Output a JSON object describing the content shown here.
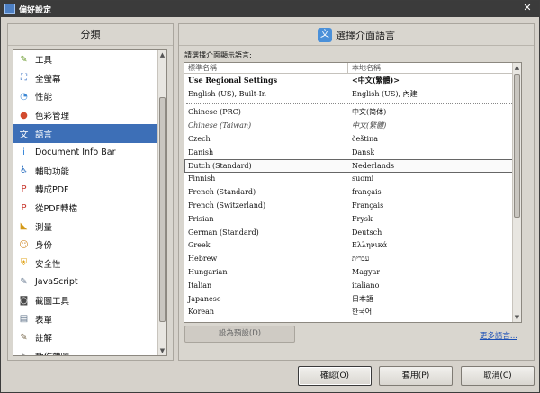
{
  "window": {
    "title": "偏好設定"
  },
  "left": {
    "header": "分類",
    "items": [
      {
        "label": "工具",
        "icon": "tools-icon",
        "color": "#6a9b2e"
      },
      {
        "label": "全螢幕",
        "icon": "fullscreen-icon",
        "color": "#3f76c6"
      },
      {
        "label": "性能",
        "icon": "performance-icon",
        "color": "#3b87d4"
      },
      {
        "label": "色彩管理",
        "icon": "color-management-icon",
        "color": "#d24b2e"
      },
      {
        "label": "語言",
        "icon": "language-icon",
        "color": "#4a90d9"
      },
      {
        "label": "Document Info Bar",
        "icon": "info-icon",
        "color": "#2a7fd6"
      },
      {
        "label": "輔助功能",
        "icon": "accessibility-icon",
        "color": "#2b6fc0"
      },
      {
        "label": "轉成PDF",
        "icon": "to-pdf-icon",
        "color": "#c8372d"
      },
      {
        "label": "從PDF轉檔",
        "icon": "from-pdf-icon",
        "color": "#c8372d"
      },
      {
        "label": "測量",
        "icon": "ruler-icon",
        "color": "#d49a1a"
      },
      {
        "label": "身份",
        "icon": "identity-icon",
        "color": "#d08a2b"
      },
      {
        "label": "安全性",
        "icon": "shield-icon",
        "color": "#e0a319"
      },
      {
        "label": "JavaScript",
        "icon": "javascript-icon",
        "color": "#6b7d93"
      },
      {
        "label": "截圖工具",
        "icon": "camera-icon",
        "color": "#4a4a4a"
      },
      {
        "label": "表單",
        "icon": "form-icon",
        "color": "#5b6f86"
      },
      {
        "label": "註解",
        "icon": "comment-icon",
        "color": "#7a6a4f"
      },
      {
        "label": "動作帶圖",
        "icon": "action-icon",
        "color": "#999"
      }
    ]
  },
  "right": {
    "header": "選擇介面語言",
    "instruction": "請選擇介面顯示語言:",
    "col1": "標準名稱",
    "col2": "本地名稱",
    "top_rows": [
      {
        "std": "Use Regional Settings",
        "local": "<中文(繁體)>",
        "style": "bold"
      },
      {
        "std": "English (US), Built-In",
        "local": "English (US), 內建",
        "style": ""
      }
    ],
    "rows": [
      {
        "std": "Chinese (PRC)",
        "local": "中文(简体)",
        "style": ""
      },
      {
        "std": "Chinese (Taiwan)",
        "local": "中文(繁體)",
        "style": "italic"
      },
      {
        "std": "Czech",
        "local": "čeština",
        "style": ""
      },
      {
        "std": "Danish",
        "local": "Dansk",
        "style": ""
      },
      {
        "std": "Dutch (Standard)",
        "local": "Nederlands",
        "style": "selected"
      },
      {
        "std": "Finnish",
        "local": "suomi",
        "style": ""
      },
      {
        "std": "French (Standard)",
        "local": "français",
        "style": ""
      },
      {
        "std": "French (Switzerland)",
        "local": "Français",
        "style": ""
      },
      {
        "std": "Frisian",
        "local": "Frysk",
        "style": ""
      },
      {
        "std": "German (Standard)",
        "local": "Deutsch",
        "style": ""
      },
      {
        "std": "Greek",
        "local": "Ελληνικά",
        "style": ""
      },
      {
        "std": "Hebrew",
        "local": "עברית",
        "style": ""
      },
      {
        "std": "Hungarian",
        "local": "Magyar",
        "style": ""
      },
      {
        "std": "Italian",
        "local": "italiano",
        "style": ""
      },
      {
        "std": "Japanese",
        "local": "日本語",
        "style": ""
      },
      {
        "std": "Korean",
        "local": "한국어",
        "style": ""
      }
    ],
    "default_button": "設為預設(D)",
    "more_link": "更多語言..."
  },
  "footer": {
    "ok": "確認(O)",
    "apply": "套用(P)",
    "cancel": "取消(C)"
  }
}
